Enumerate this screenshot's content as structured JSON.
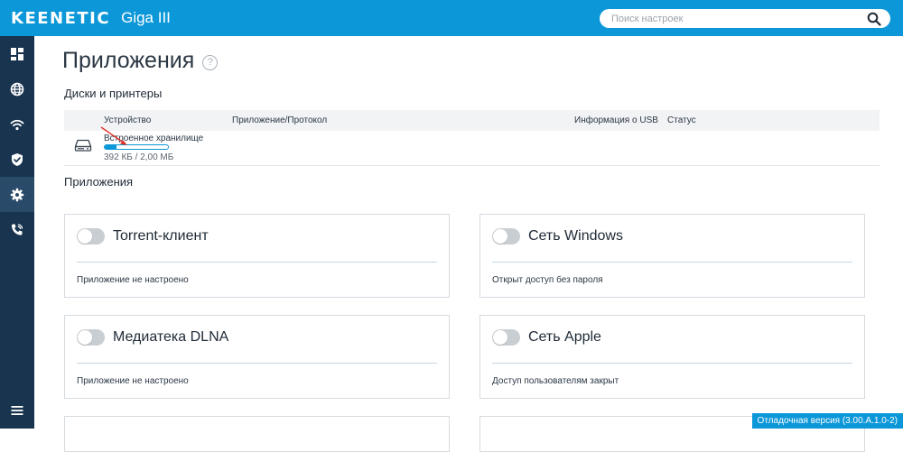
{
  "header": {
    "logo": "KEENETIC",
    "model": "Giga III",
    "search": {
      "placeholder": "Поиск настроек"
    }
  },
  "sidebar": {
    "items": [
      {
        "name": "dashboard",
        "icon": "dashboard-icon"
      },
      {
        "name": "internet",
        "icon": "globe-icon"
      },
      {
        "name": "wifi",
        "icon": "wifi-icon"
      },
      {
        "name": "security",
        "icon": "shield-icon"
      },
      {
        "name": "settings",
        "icon": "gear-icon",
        "active": true
      },
      {
        "name": "telephony",
        "icon": "phone-icon"
      }
    ],
    "menu_icon": "menu-icon"
  },
  "page": {
    "title": "Приложения",
    "help": "?"
  },
  "disks": {
    "section_title": "Диски и принтеры",
    "columns": [
      "Устройство",
      "Приложение/Протокол",
      "Информация о USB",
      "Статус"
    ],
    "rows": [
      {
        "name": "Встроенное хранилище",
        "size": "392 КБ / 2,00 МБ",
        "used_fraction": 0.19
      }
    ]
  },
  "apps": {
    "section_title": "Приложения",
    "cards": [
      {
        "title": "Torrent-клиент",
        "status": "Приложение не настроено",
        "enabled": false
      },
      {
        "title": "Сеть Windows",
        "status": "Открыт доступ без пароля",
        "enabled": false
      },
      {
        "title": "Медиатека DLNA",
        "status": "Приложение не настроено",
        "enabled": false
      },
      {
        "title": "Сеть Apple",
        "status": "Доступ пользователям закрыт",
        "enabled": false
      }
    ]
  },
  "footer": {
    "debug_label": "Отладочная версия (3.00.A.1.0-2)"
  },
  "colors": {
    "header": "#0c97d8",
    "sidebar": "#18344f",
    "sidebar_active": "#2a4a69",
    "accent": "#0c97d8"
  }
}
